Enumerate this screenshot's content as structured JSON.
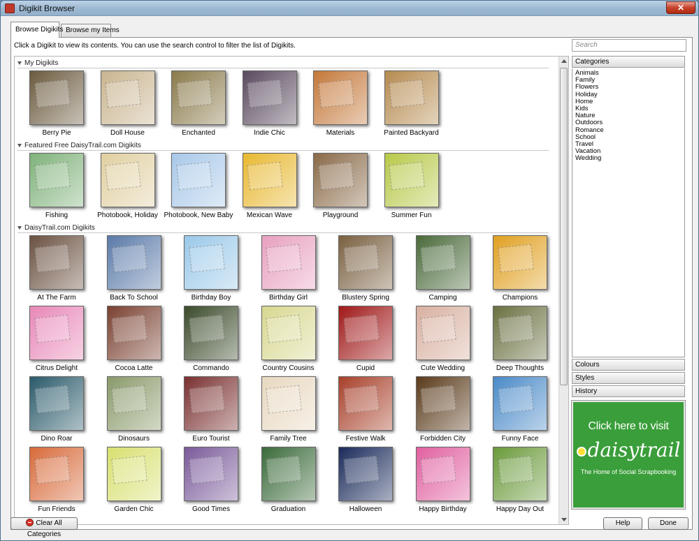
{
  "window": {
    "title": "Digikit Browser",
    "close_glyph": "✕"
  },
  "tabs": [
    {
      "label": "Browse Digikits",
      "active": true
    },
    {
      "label": "Browse my Items",
      "active": false
    }
  ],
  "instructions": "Click a Digikit to view its contents. You can use the search control to filter the list of Digikits.",
  "search": {
    "placeholder": "Search"
  },
  "sections": [
    {
      "title": "My Digikits",
      "items": [
        {
          "label": "Berry Pie",
          "color": "#6b5a3e"
        },
        {
          "label": "Doll House",
          "color": "#c9b48f"
        },
        {
          "label": "Enchanted",
          "color": "#8a7a4a"
        },
        {
          "label": "Indie Chic",
          "color": "#5a4a5e"
        },
        {
          "label": "Materials",
          "color": "#c4783a"
        },
        {
          "label": "Painted Backyard",
          "color": "#b58a4e"
        }
      ]
    },
    {
      "title": "Featured Free DaisyTrail.com Digikits",
      "items": [
        {
          "label": "Fishing",
          "color": "#7fb27a"
        },
        {
          "label": "Photobook, Holiday",
          "color": "#e0cfa0"
        },
        {
          "label": "Photobook, New Baby",
          "color": "#a8c8e8"
        },
        {
          "label": "Mexican Wave",
          "color": "#e8b830"
        },
        {
          "label": "Playground",
          "color": "#8a6a48"
        },
        {
          "label": "Summer Fun",
          "color": "#b8c848"
        }
      ]
    },
    {
      "title": "DaisyTrail.com Digikits",
      "items": [
        {
          "label": "At The Farm",
          "color": "#6a5040"
        },
        {
          "label": "Back To School",
          "color": "#5a7aa8"
        },
        {
          "label": "Birthday Boy",
          "color": "#9ac8e8"
        },
        {
          "label": "Birthday Girl",
          "color": "#e8a0c0"
        },
        {
          "label": "Blustery Spring",
          "color": "#7a6040"
        },
        {
          "label": "Camping",
          "color": "#4a6a3a"
        },
        {
          "label": "Champions",
          "color": "#e0a020"
        },
        {
          "label": "Citrus Delight",
          "color": "#e888b8"
        },
        {
          "label": "Cocoa Latte",
          "color": "#7a4030"
        },
        {
          "label": "Commando",
          "color": "#3a4a2a"
        },
        {
          "label": "Country Cousins",
          "color": "#d8d890"
        },
        {
          "label": "Cupid",
          "color": "#a01818"
        },
        {
          "label": "Cute Wedding",
          "color": "#d8b0a0"
        },
        {
          "label": "Deep Thoughts",
          "color": "#6a7040"
        },
        {
          "label": "Dino Roar",
          "color": "#2a5a6a"
        },
        {
          "label": "Dinosaurs",
          "color": "#8a9a6a"
        },
        {
          "label": "Euro Tourist",
          "color": "#7a3030"
        },
        {
          "label": "Family Tree",
          "color": "#e8d8c0"
        },
        {
          "label": "Festive Walk",
          "color": "#a8402a"
        },
        {
          "label": "Forbidden City",
          "color": "#5a3a1a"
        },
        {
          "label": "Funny Face",
          "color": "#4a8ac8"
        },
        {
          "label": "Fun Friends",
          "color": "#d86a3a"
        },
        {
          "label": "Garden Chic",
          "color": "#d8e070"
        },
        {
          "label": "Good Times",
          "color": "#7a5a9a"
        },
        {
          "label": "Graduation",
          "color": "#3a6a3a"
        },
        {
          "label": "Halloween",
          "color": "#1a2a5a"
        },
        {
          "label": "Happy Birthday",
          "color": "#e060a0"
        },
        {
          "label": "Happy Day Out",
          "color": "#6a9a3a"
        }
      ]
    }
  ],
  "categories": {
    "title": "Categories",
    "items": [
      "Animals",
      "Family",
      "Flowers",
      "Holiday",
      "Home",
      "Kids",
      "Nature",
      "Outdoors",
      "Romance",
      "School",
      "Travel",
      "Vacation",
      "Wedding"
    ]
  },
  "collapsed_panels": [
    "Colours",
    "Styles",
    "History"
  ],
  "banner": {
    "cta": "Click here to visit",
    "logo": "daisytrail",
    "tagline": "The Home of Social Scrapbooking"
  },
  "buttons": {
    "clear": "Clear All Categories",
    "help": "Help",
    "done": "Done"
  }
}
